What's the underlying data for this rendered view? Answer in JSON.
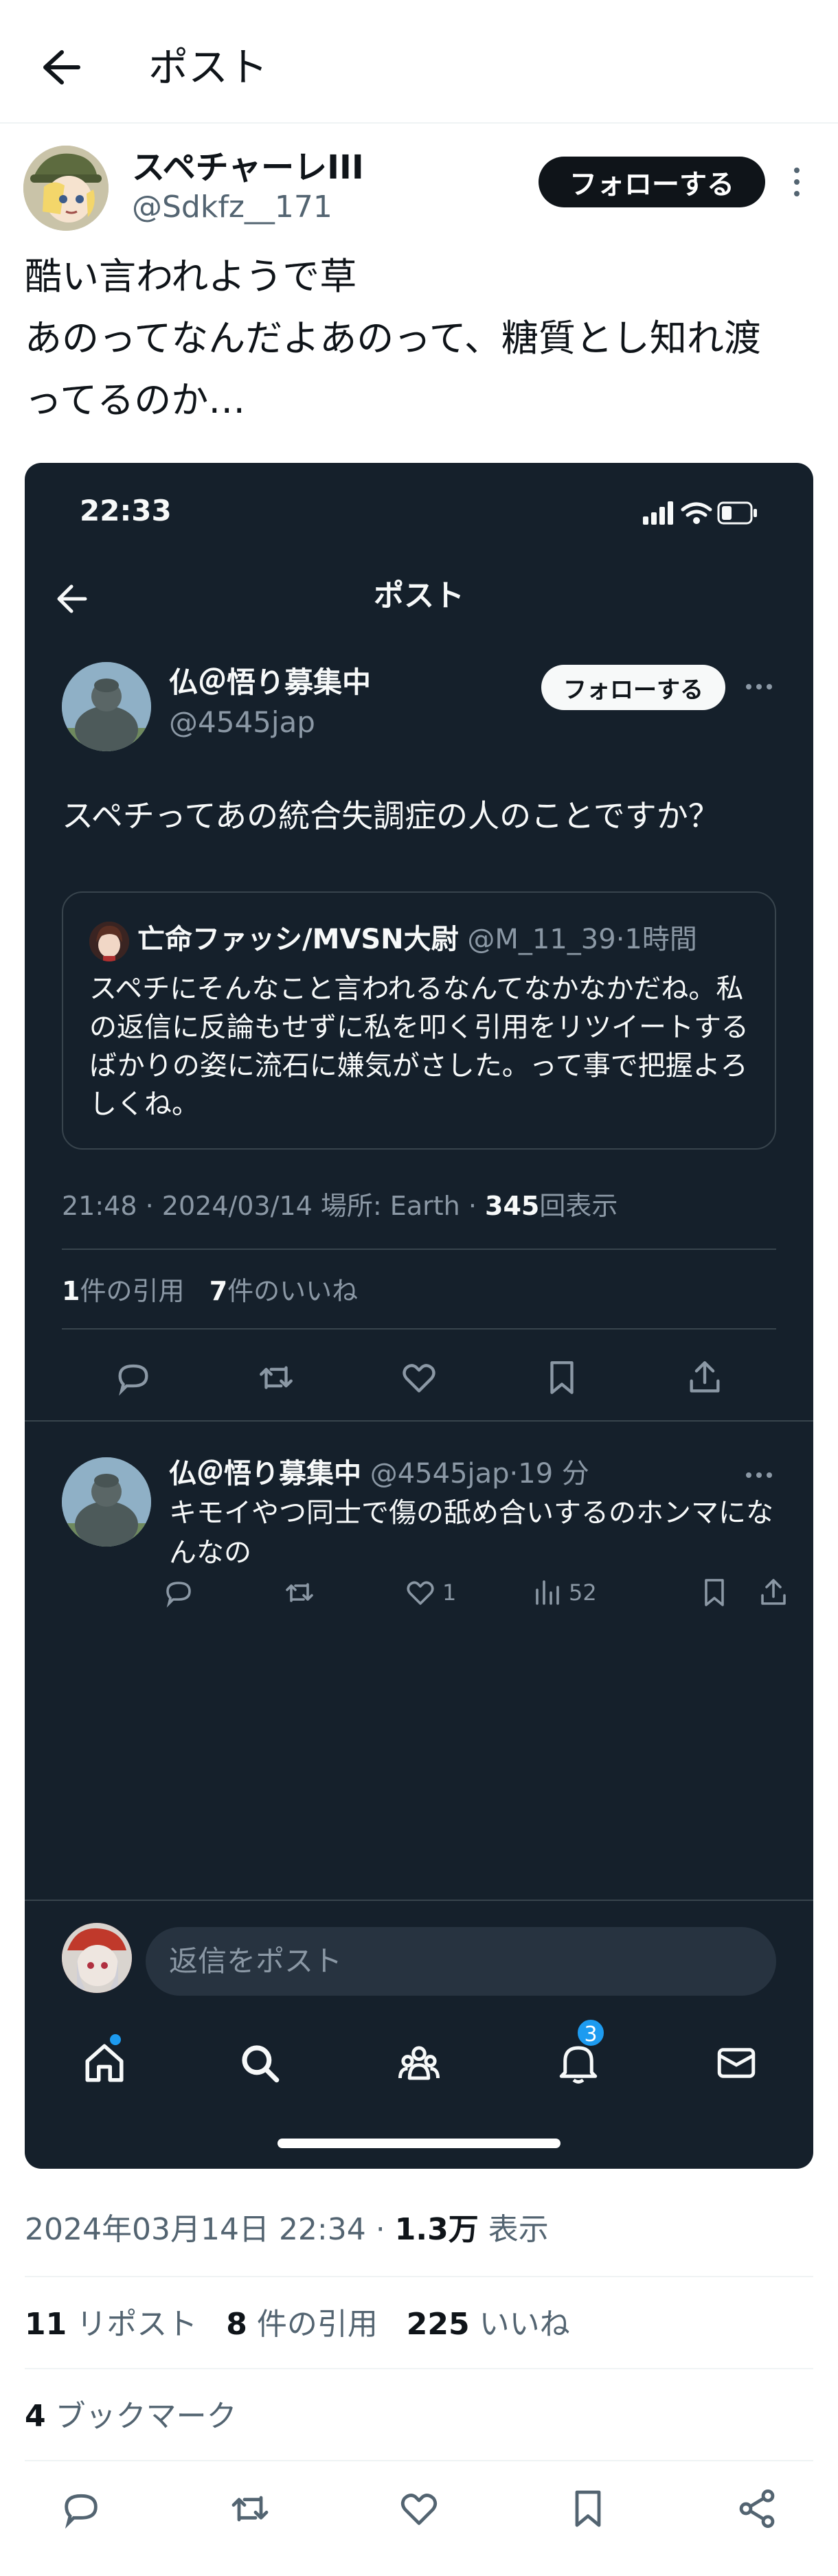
{
  "header": {
    "title": "ポスト"
  },
  "author": {
    "name": "スペチャーレIII",
    "handle": "@Sdkfz__171",
    "follow_label": "フォローする"
  },
  "tweet": {
    "lines": [
      "酷い言われようで草",
      "あのってなんだよあのって、糖質とし知れ渡",
      "ってるのか…"
    ]
  },
  "screenshot": {
    "status_time": "22:33",
    "title": "ポスト",
    "post": {
      "name": "仏＠悟り募集中",
      "handle": "@4545jap",
      "follow_label": "フォローする",
      "text": "スペチってあの統合失調症の人のことですか？"
    },
    "quote": {
      "name": "亡命ファッシ/MVSN大尉",
      "handle": "@M_11_39",
      "time": "1時間",
      "text": "スペチにそんなこと言われるなんてなかなかだね。私の返信に反論もせずに私を叩く引用をリツイートするばかりの姿に流石に嫌気がさした。って事で把握よろしくね。"
    },
    "meta": {
      "time": "21:48",
      "date": "2024/03/14",
      "location": "場所: Earth",
      "views": "345",
      "views_label": "回表示"
    },
    "stats": {
      "quotes": "1",
      "quotes_label": "件の引用",
      "likes": "7",
      "likes_label": "件のいいね"
    },
    "reply": {
      "name": "仏＠悟り募集中",
      "handle": "@4545jap",
      "time": "19 分",
      "text": "キモイやつ同士で傷の舐め合いするのホンマになんなの",
      "likes": "1",
      "views": "52"
    },
    "reply_placeholder": "返信をポスト",
    "notif_badge": "3"
  },
  "footer": {
    "date": "2024年03月14日 22:34",
    "views": "1.3万",
    "views_label": "表示",
    "reposts": "11",
    "reposts_label": "リポスト",
    "quotes": "8",
    "quotes_label": "件の引用",
    "likes": "225",
    "likes_label": "いいね",
    "bookmarks": "4",
    "bookmarks_label": "ブックマーク"
  },
  "icons": [
    "back-arrow-icon",
    "more-icon",
    "reply-icon",
    "repost-icon",
    "like-icon",
    "bookmark-icon",
    "share-icon",
    "views-icon",
    "home-icon",
    "search-icon",
    "communities-icon",
    "notifications-icon",
    "messages-icon",
    "signal-icon",
    "wifi-icon",
    "battery-icon"
  ],
  "colors": {
    "dark_bg": "#15202b",
    "accent": "#1d9bf0",
    "dim_text": "#8b98a5",
    "light_text": "#f7f9f9"
  }
}
